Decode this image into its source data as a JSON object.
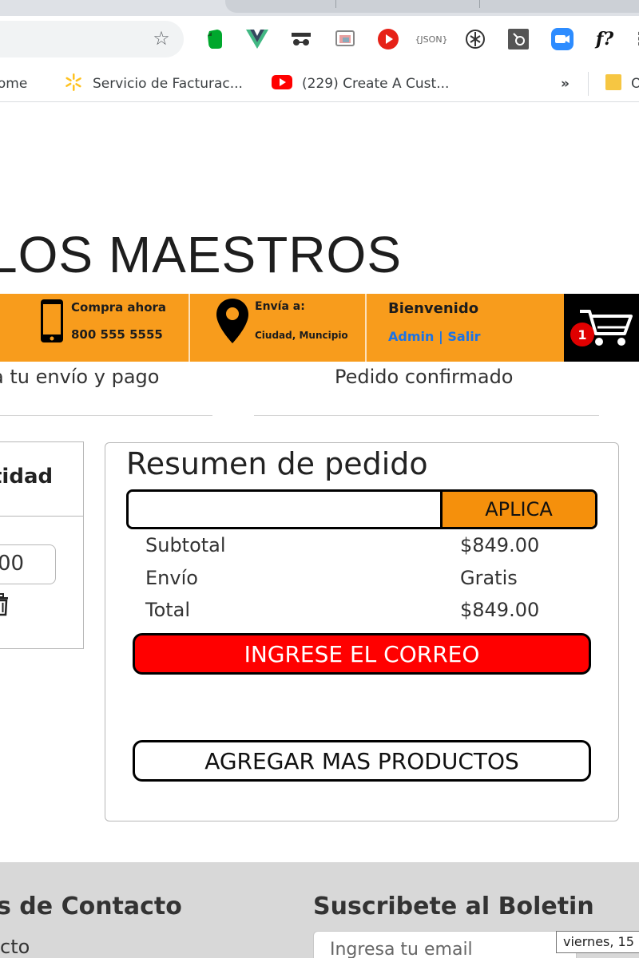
{
  "browser": {
    "extensions": [
      "evernote-icon",
      "vue-devtools-icon",
      "incognito-ext-icon",
      "colorzilla-icon",
      "youtube-ext-icon",
      "json-formatter-icon",
      "chatgpt-icon",
      "hubspot-icon",
      "zoom-icon",
      "font-finder-icon"
    ],
    "font_finder_label": "f?",
    "json_label": "{JSON}",
    "bookmarks": [
      {
        "label": "some",
        "icon": "bookmark-icon"
      },
      {
        "label": "Servicio de Facturac...",
        "icon": "walmart-icon"
      },
      {
        "label": "(229) Create A Cust...",
        "icon": "youtube-icon"
      }
    ],
    "overflow_label": "»",
    "folder_label": "O"
  },
  "header": {
    "brand": "LOS MAESTROS",
    "phone": {
      "title": "Compra ahora",
      "number": "800 555 5555"
    },
    "location": {
      "title": "Envía a:",
      "place": "Ciudad, Muncipio"
    },
    "account": {
      "greeting": "Bienvenido",
      "user": "Admin",
      "sep": "|",
      "logout": "Salir"
    },
    "cart": {
      "count": "1"
    }
  },
  "steps": {
    "step_left": "a tu envío y pago",
    "step_right": "Pedido confirmado"
  },
  "cart_table": {
    "header": "tidad",
    "quantity": "00"
  },
  "summary": {
    "title": "Resumen de pedido",
    "coupon_placeholder": "",
    "apply_label": "APLICA",
    "rows": [
      {
        "label": "Subtotal",
        "value": "$849.00"
      },
      {
        "label": "Envío",
        "value": "Gratis"
      },
      {
        "label": "Total",
        "value": "$849.00"
      }
    ],
    "email_button": "INGRESE EL CORREO",
    "more_button": "AGREGAR MAS PRODUCTOS"
  },
  "footer": {
    "contact_title": "s de Contacto",
    "contact_sub": "cto",
    "newsletter_title": "Suscribete al Boletin",
    "email_placeholder": "Ingresa tu email"
  },
  "tooltip": "viernes, 15",
  "colors": {
    "orange": "#f89c1c",
    "apply": "#f5900c",
    "red_button": "#ff0000",
    "cart_badge": "#e00000",
    "link": "#1a73e8"
  }
}
